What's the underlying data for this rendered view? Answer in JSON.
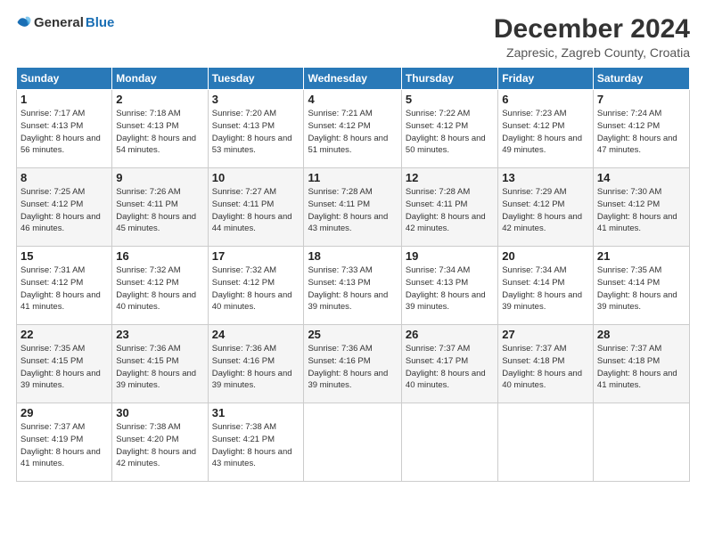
{
  "logo": {
    "text_general": "General",
    "text_blue": "Blue"
  },
  "title": "December 2024",
  "subtitle": "Zapresic, Zagreb County, Croatia",
  "days_of_week": [
    "Sunday",
    "Monday",
    "Tuesday",
    "Wednesday",
    "Thursday",
    "Friday",
    "Saturday"
  ],
  "weeks": [
    [
      {
        "day": "1",
        "sunrise": "Sunrise: 7:17 AM",
        "sunset": "Sunset: 4:13 PM",
        "daylight": "Daylight: 8 hours and 56 minutes."
      },
      {
        "day": "2",
        "sunrise": "Sunrise: 7:18 AM",
        "sunset": "Sunset: 4:13 PM",
        "daylight": "Daylight: 8 hours and 54 minutes."
      },
      {
        "day": "3",
        "sunrise": "Sunrise: 7:20 AM",
        "sunset": "Sunset: 4:13 PM",
        "daylight": "Daylight: 8 hours and 53 minutes."
      },
      {
        "day": "4",
        "sunrise": "Sunrise: 7:21 AM",
        "sunset": "Sunset: 4:12 PM",
        "daylight": "Daylight: 8 hours and 51 minutes."
      },
      {
        "day": "5",
        "sunrise": "Sunrise: 7:22 AM",
        "sunset": "Sunset: 4:12 PM",
        "daylight": "Daylight: 8 hours and 50 minutes."
      },
      {
        "day": "6",
        "sunrise": "Sunrise: 7:23 AM",
        "sunset": "Sunset: 4:12 PM",
        "daylight": "Daylight: 8 hours and 49 minutes."
      },
      {
        "day": "7",
        "sunrise": "Sunrise: 7:24 AM",
        "sunset": "Sunset: 4:12 PM",
        "daylight": "Daylight: 8 hours and 47 minutes."
      }
    ],
    [
      {
        "day": "8",
        "sunrise": "Sunrise: 7:25 AM",
        "sunset": "Sunset: 4:12 PM",
        "daylight": "Daylight: 8 hours and 46 minutes."
      },
      {
        "day": "9",
        "sunrise": "Sunrise: 7:26 AM",
        "sunset": "Sunset: 4:11 PM",
        "daylight": "Daylight: 8 hours and 45 minutes."
      },
      {
        "day": "10",
        "sunrise": "Sunrise: 7:27 AM",
        "sunset": "Sunset: 4:11 PM",
        "daylight": "Daylight: 8 hours and 44 minutes."
      },
      {
        "day": "11",
        "sunrise": "Sunrise: 7:28 AM",
        "sunset": "Sunset: 4:11 PM",
        "daylight": "Daylight: 8 hours and 43 minutes."
      },
      {
        "day": "12",
        "sunrise": "Sunrise: 7:28 AM",
        "sunset": "Sunset: 4:11 PM",
        "daylight": "Daylight: 8 hours and 42 minutes."
      },
      {
        "day": "13",
        "sunrise": "Sunrise: 7:29 AM",
        "sunset": "Sunset: 4:12 PM",
        "daylight": "Daylight: 8 hours and 42 minutes."
      },
      {
        "day": "14",
        "sunrise": "Sunrise: 7:30 AM",
        "sunset": "Sunset: 4:12 PM",
        "daylight": "Daylight: 8 hours and 41 minutes."
      }
    ],
    [
      {
        "day": "15",
        "sunrise": "Sunrise: 7:31 AM",
        "sunset": "Sunset: 4:12 PM",
        "daylight": "Daylight: 8 hours and 41 minutes."
      },
      {
        "day": "16",
        "sunrise": "Sunrise: 7:32 AM",
        "sunset": "Sunset: 4:12 PM",
        "daylight": "Daylight: 8 hours and 40 minutes."
      },
      {
        "day": "17",
        "sunrise": "Sunrise: 7:32 AM",
        "sunset": "Sunset: 4:12 PM",
        "daylight": "Daylight: 8 hours and 40 minutes."
      },
      {
        "day": "18",
        "sunrise": "Sunrise: 7:33 AM",
        "sunset": "Sunset: 4:13 PM",
        "daylight": "Daylight: 8 hours and 39 minutes."
      },
      {
        "day": "19",
        "sunrise": "Sunrise: 7:34 AM",
        "sunset": "Sunset: 4:13 PM",
        "daylight": "Daylight: 8 hours and 39 minutes."
      },
      {
        "day": "20",
        "sunrise": "Sunrise: 7:34 AM",
        "sunset": "Sunset: 4:14 PM",
        "daylight": "Daylight: 8 hours and 39 minutes."
      },
      {
        "day": "21",
        "sunrise": "Sunrise: 7:35 AM",
        "sunset": "Sunset: 4:14 PM",
        "daylight": "Daylight: 8 hours and 39 minutes."
      }
    ],
    [
      {
        "day": "22",
        "sunrise": "Sunrise: 7:35 AM",
        "sunset": "Sunset: 4:15 PM",
        "daylight": "Daylight: 8 hours and 39 minutes."
      },
      {
        "day": "23",
        "sunrise": "Sunrise: 7:36 AM",
        "sunset": "Sunset: 4:15 PM",
        "daylight": "Daylight: 8 hours and 39 minutes."
      },
      {
        "day": "24",
        "sunrise": "Sunrise: 7:36 AM",
        "sunset": "Sunset: 4:16 PM",
        "daylight": "Daylight: 8 hours and 39 minutes."
      },
      {
        "day": "25",
        "sunrise": "Sunrise: 7:36 AM",
        "sunset": "Sunset: 4:16 PM",
        "daylight": "Daylight: 8 hours and 39 minutes."
      },
      {
        "day": "26",
        "sunrise": "Sunrise: 7:37 AM",
        "sunset": "Sunset: 4:17 PM",
        "daylight": "Daylight: 8 hours and 40 minutes."
      },
      {
        "day": "27",
        "sunrise": "Sunrise: 7:37 AM",
        "sunset": "Sunset: 4:18 PM",
        "daylight": "Daylight: 8 hours and 40 minutes."
      },
      {
        "day": "28",
        "sunrise": "Sunrise: 7:37 AM",
        "sunset": "Sunset: 4:18 PM",
        "daylight": "Daylight: 8 hours and 41 minutes."
      }
    ],
    [
      {
        "day": "29",
        "sunrise": "Sunrise: 7:37 AM",
        "sunset": "Sunset: 4:19 PM",
        "daylight": "Daylight: 8 hours and 41 minutes."
      },
      {
        "day": "30",
        "sunrise": "Sunrise: 7:38 AM",
        "sunset": "Sunset: 4:20 PM",
        "daylight": "Daylight: 8 hours and 42 minutes."
      },
      {
        "day": "31",
        "sunrise": "Sunrise: 7:38 AM",
        "sunset": "Sunset: 4:21 PM",
        "daylight": "Daylight: 8 hours and 43 minutes."
      },
      null,
      null,
      null,
      null
    ]
  ]
}
